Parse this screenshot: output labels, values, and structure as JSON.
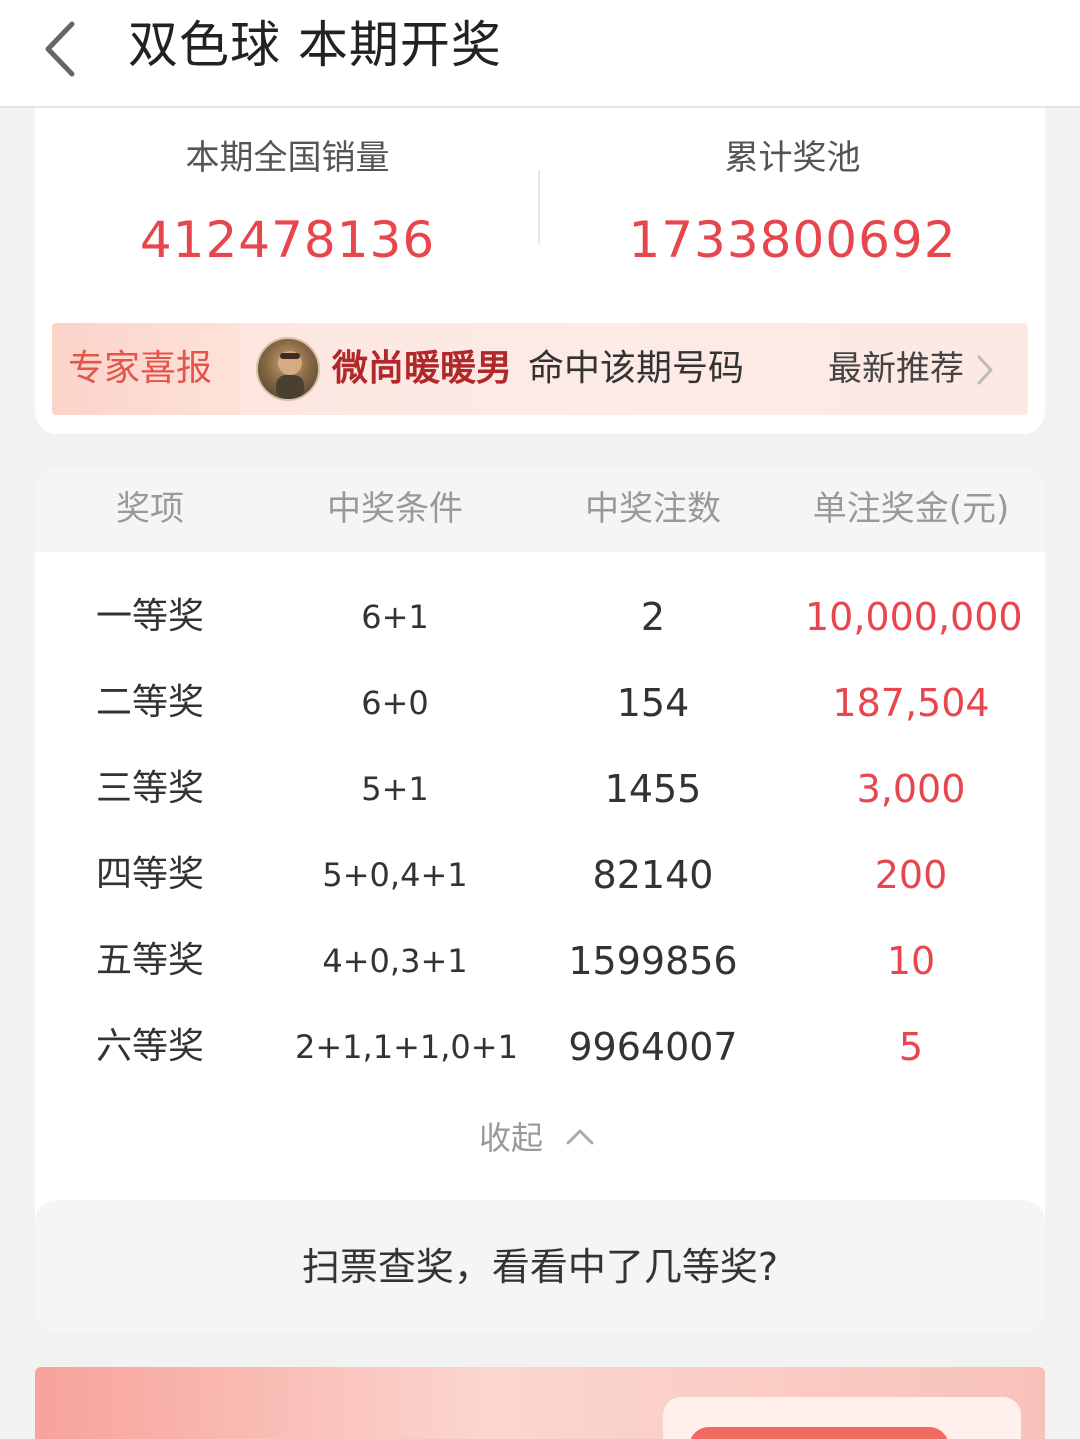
{
  "header": {
    "title": "双色球 本期开奖"
  },
  "summary": {
    "sales_label": "本期全国销量",
    "sales_value": "412478136",
    "pool_label": "累计奖池",
    "pool_value": "1733800692"
  },
  "expert": {
    "tag": "专家喜报",
    "name": "微尚暖暖男",
    "text": "命中该期号码",
    "link": "最新推荐"
  },
  "prize_table": {
    "headers": [
      "奖项",
      "中奖条件",
      "中奖注数",
      "单注奖金(元)"
    ],
    "rows": [
      {
        "level": "一等奖",
        "condition": "6+1",
        "count": "2",
        "amount": "10,000,000"
      },
      {
        "level": "二等奖",
        "condition": "6+0",
        "count": "154",
        "amount": "187,504"
      },
      {
        "level": "三等奖",
        "condition": "5+1",
        "count": "1455",
        "amount": "3,000"
      },
      {
        "level": "四等奖",
        "condition": "5+0,4+1",
        "count": "82140",
        "amount": "200"
      },
      {
        "level": "五等奖",
        "condition": "4+0,3+1",
        "count": "1599856",
        "amount": "10"
      },
      {
        "level": "六等奖",
        "condition": "2+1,1+1,0+1",
        "count": "9964007",
        "amount": "5"
      }
    ],
    "collapse_label": "收起"
  },
  "scan": {
    "text": "扫票查奖，看看中了几等奖?"
  },
  "colors": {
    "accent_red": "#e8464d",
    "expert_name": "#b0282a",
    "muted": "#999999"
  }
}
